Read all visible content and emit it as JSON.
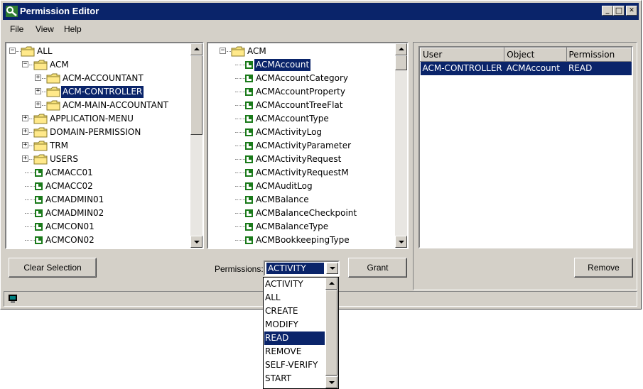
{
  "window": {
    "title": "Permission Editor",
    "minimize": "_",
    "maximize": "□",
    "close": "✕"
  },
  "menu": [
    {
      "label": "File"
    },
    {
      "label": "View"
    },
    {
      "label": "Help"
    }
  ],
  "left_tree": {
    "items": [
      {
        "label": "ALL",
        "type": "folder",
        "level": 0,
        "expander": "−"
      },
      {
        "label": "ACM",
        "type": "folder",
        "level": 1,
        "expander": "−"
      },
      {
        "label": "ACM-ACCOUNTANT",
        "type": "folder",
        "level": 2,
        "expander": "+"
      },
      {
        "label": "ACM-CONTROLLER",
        "type": "folder",
        "level": 2,
        "expander": "+",
        "selected": true
      },
      {
        "label": "ACM-MAIN-ACCOUNTANT",
        "type": "folder",
        "level": 2,
        "expander": "+"
      },
      {
        "label": "APPLICATION-MENU",
        "type": "folder",
        "level": 1,
        "expander": "+"
      },
      {
        "label": "DOMAIN-PERMISSION",
        "type": "folder",
        "level": 1,
        "expander": "+"
      },
      {
        "label": "TRM",
        "type": "folder",
        "level": 1,
        "expander": "+"
      },
      {
        "label": "USERS",
        "type": "folder",
        "level": 1,
        "expander": "+"
      },
      {
        "label": "ACMACC01",
        "type": "leaf",
        "level": 1
      },
      {
        "label": "ACMACC02",
        "type": "leaf",
        "level": 1
      },
      {
        "label": "ACMADMIN01",
        "type": "leaf",
        "level": 1
      },
      {
        "label": "ACMADMIN02",
        "type": "leaf",
        "level": 1
      },
      {
        "label": "ACMCON01",
        "type": "leaf",
        "level": 1
      },
      {
        "label": "ACMCON02",
        "type": "leaf",
        "level": 1
      }
    ]
  },
  "middle_tree": {
    "items": [
      {
        "label": "ACM",
        "type": "folder",
        "level": 0,
        "expander": "−"
      },
      {
        "label": "ACMAccount",
        "type": "leaf",
        "level": 1,
        "selected": true
      },
      {
        "label": "ACMAccountCategory",
        "type": "leaf",
        "level": 1
      },
      {
        "label": "ACMAccountProperty",
        "type": "leaf",
        "level": 1
      },
      {
        "label": "ACMAccountTreeFlat",
        "type": "leaf",
        "level": 1
      },
      {
        "label": "ACMAccountType",
        "type": "leaf",
        "level": 1
      },
      {
        "label": "ACMActivityLog",
        "type": "leaf",
        "level": 1
      },
      {
        "label": "ACMActivityParameter",
        "type": "leaf",
        "level": 1
      },
      {
        "label": "ACMActivityRequest",
        "type": "leaf",
        "level": 1
      },
      {
        "label": "ACMActivityRequestM",
        "type": "leaf",
        "level": 1
      },
      {
        "label": "ACMAuditLog",
        "type": "leaf",
        "level": 1
      },
      {
        "label": "ACMBalance",
        "type": "leaf",
        "level": 1
      },
      {
        "label": "ACMBalanceCheckpoint",
        "type": "leaf",
        "level": 1
      },
      {
        "label": "ACMBalanceType",
        "type": "leaf",
        "level": 1
      },
      {
        "label": "ACMBookkeepingType",
        "type": "leaf",
        "level": 1
      }
    ]
  },
  "table": {
    "columns": [
      "User",
      "Object",
      "Permission"
    ],
    "rows": [
      [
        "ACM-CONTROLLER",
        "ACMAccount",
        "READ"
      ]
    ]
  },
  "buttons": {
    "clear_selection": "Clear Selection",
    "grant": "Grant",
    "remove": "Remove"
  },
  "permissions": {
    "label": "Permissions:",
    "selected": "ACTIVITY",
    "options": [
      "ACTIVITY",
      "ALL",
      "CREATE",
      "MODIFY",
      "READ",
      "REMOVE",
      "SELF-VERIFY",
      "START"
    ],
    "highlighted": "READ"
  },
  "colors": {
    "selection": "#0a246a",
    "face": "#d4d0c8",
    "titlebar": "#0a246a"
  }
}
